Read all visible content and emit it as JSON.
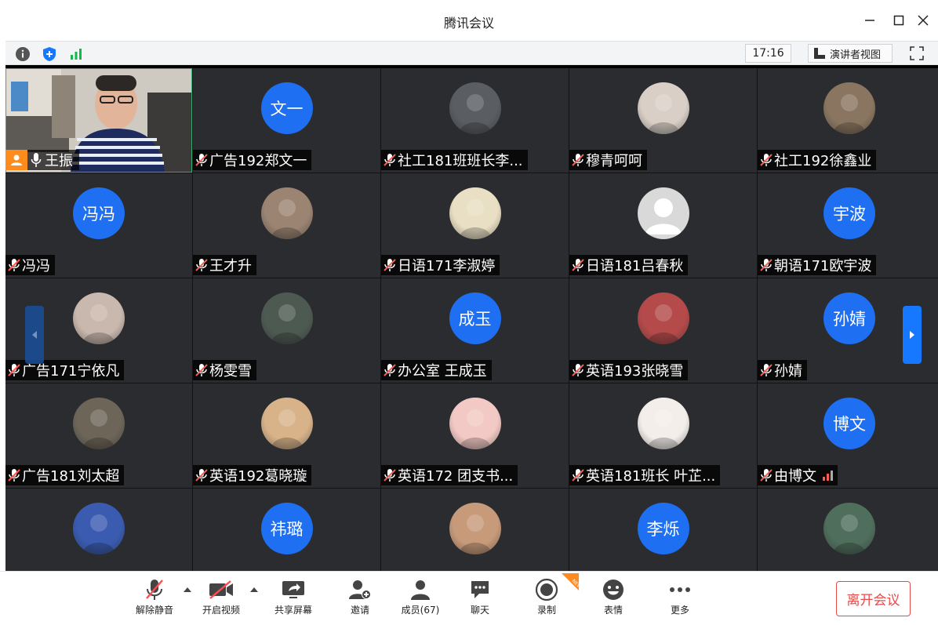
{
  "window": {
    "title": "腾讯会议"
  },
  "infobar": {
    "time": "17:16",
    "speaker_view_label": "演讲者视图"
  },
  "participants": [
    {
      "name": "王振",
      "avatar_type": "video",
      "host": true
    },
    {
      "name": "广告192郑文一",
      "avatar_type": "text",
      "avatar_text": "文一"
    },
    {
      "name": "社工181班班长李...",
      "avatar_type": "photo",
      "avatar_color": "#5a5d61"
    },
    {
      "name": "穆青呵呵",
      "avatar_type": "photo",
      "avatar_color": "#d9cfc6"
    },
    {
      "name": "社工192徐鑫业",
      "avatar_type": "photo",
      "avatar_color": "#8a7660"
    },
    {
      "name": "冯冯",
      "avatar_type": "text",
      "avatar_text": "冯冯"
    },
    {
      "name": "王才升",
      "avatar_type": "photo",
      "avatar_color": "#9b8472"
    },
    {
      "name": "日语171李淑婷",
      "avatar_type": "photo",
      "avatar_color": "#e9dfc4"
    },
    {
      "name": "日语181吕春秋",
      "avatar_type": "default",
      "avatar_color": "#d9d9d9"
    },
    {
      "name": "朝语171欧宇波",
      "avatar_type": "text",
      "avatar_text": "宇波"
    },
    {
      "name": "广告171宁依凡",
      "avatar_type": "photo",
      "avatar_color": "#c9b8ad"
    },
    {
      "name": "杨雯雪",
      "avatar_type": "photo",
      "avatar_color": "#4d5a52"
    },
    {
      "name": "办公室 王成玉",
      "avatar_type": "text",
      "avatar_text": "成玉"
    },
    {
      "name": "英语193张晓雪",
      "avatar_type": "photo",
      "avatar_color": "#b44a4a"
    },
    {
      "name": "孙婧",
      "avatar_type": "text",
      "avatar_text": "孙婧"
    },
    {
      "name": "广告181刘太超",
      "avatar_type": "photo",
      "avatar_color": "#6d6558"
    },
    {
      "name": "英语192葛晓璇",
      "avatar_type": "photo",
      "avatar_color": "#d8b38a"
    },
    {
      "name": "英语172 团支书...",
      "avatar_type": "photo",
      "avatar_color": "#f2c9c4"
    },
    {
      "name": "英语181班长 叶芷...",
      "avatar_type": "photo",
      "avatar_color": "#f3eeea"
    },
    {
      "name": "由博文",
      "avatar_type": "text",
      "avatar_text": "博文",
      "signal": true
    },
    {
      "name": "",
      "avatar_type": "photo",
      "avatar_color": "#3a5bb0"
    },
    {
      "name": "",
      "avatar_type": "text",
      "avatar_text": "祎璐"
    },
    {
      "name": "",
      "avatar_type": "photo",
      "avatar_color": "#c79a7a"
    },
    {
      "name": "",
      "avatar_type": "text",
      "avatar_text": "李烁"
    },
    {
      "name": "",
      "avatar_type": "photo",
      "avatar_color": "#4f6e5c"
    }
  ],
  "toolbar": {
    "unmute": "解除静音",
    "start_video": "开启视频",
    "share_screen": "共享屏幕",
    "invite": "邀请",
    "members": "成员(67)",
    "chat": "聊天",
    "record": "录制",
    "reactions": "表情",
    "more": "更多",
    "leave": "离开会议"
  },
  "colors": {
    "accent": "#1677ff",
    "host_badge": "#ff8c1a",
    "danger": "#e84a4a",
    "muted": "#ff5a4f"
  }
}
